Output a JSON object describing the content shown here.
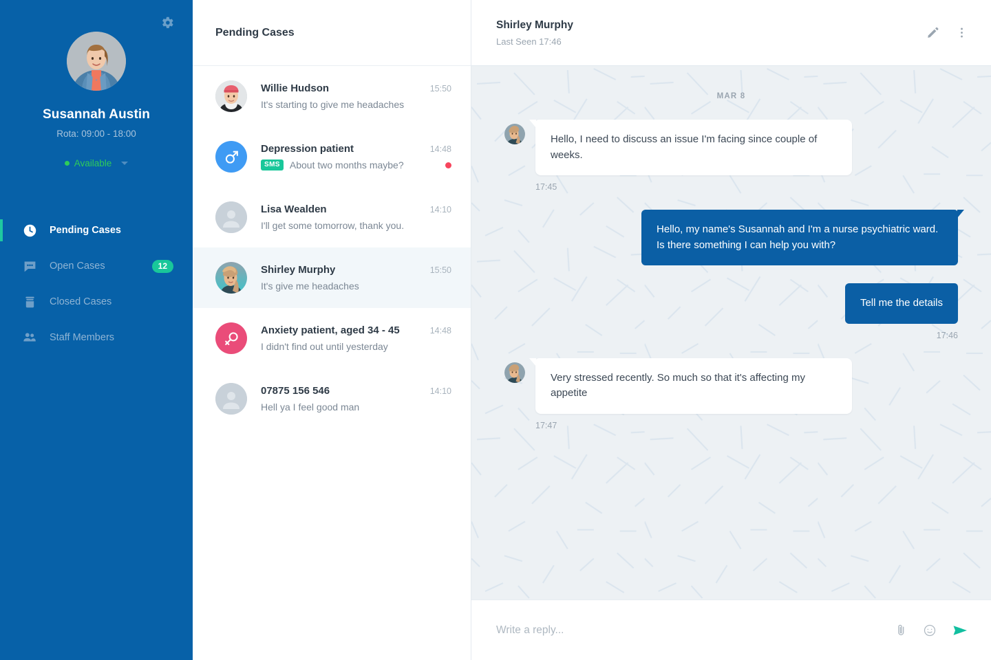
{
  "sidebar": {
    "gear_icon": "gear-icon",
    "profile": {
      "name": "Susannah Austin",
      "rota": "Rota: 09:00 - 18:00",
      "status": "Available",
      "status_color": "#2ecc5a",
      "avatar": "user-photo"
    },
    "nav": [
      {
        "label": "Pending Cases",
        "icon": "clock-icon",
        "active": true,
        "badge": ""
      },
      {
        "label": "Open Cases",
        "icon": "chat-icon",
        "active": false,
        "badge": "12"
      },
      {
        "label": "Closed Cases",
        "icon": "archive-icon",
        "active": false,
        "badge": ""
      },
      {
        "label": "Staff Members",
        "icon": "people-icon",
        "active": false,
        "badge": ""
      }
    ],
    "background_color": "#0761a8",
    "accent_color": "#1fc8a0"
  },
  "list": {
    "title": "Pending Cases",
    "cases": [
      {
        "name": "Willie Hudson",
        "preview": "It's starting to give me headaches",
        "time": "15:50",
        "avatar": "photo-man-beanie",
        "avatar_kind": "photo",
        "tag": "",
        "unread": false,
        "selected": false
      },
      {
        "name": "Depression patient",
        "preview": "About two months maybe?",
        "time": "14:48",
        "avatar": "male-symbol-icon",
        "avatar_kind": "male",
        "tag": "SMS",
        "unread": true,
        "selected": false
      },
      {
        "name": "Lisa Wealden",
        "preview": "I'll get some tomorrow, thank you.",
        "time": "14:10",
        "avatar": "placeholder-person-icon",
        "avatar_kind": "placeholder",
        "tag": "",
        "unread": false,
        "selected": false
      },
      {
        "name": "Shirley Murphy",
        "preview": "It's give me headaches",
        "time": "15:50",
        "avatar": "photo-woman",
        "avatar_kind": "photo2",
        "tag": "",
        "unread": false,
        "selected": true
      },
      {
        "name": "Anxiety patient, aged 34 - 45",
        "preview": "I didn't find out until yesterday",
        "time": "14:48",
        "avatar": "female-symbol-icon",
        "avatar_kind": "female",
        "tag": "",
        "unread": false,
        "selected": false
      },
      {
        "name": "07875 156 546",
        "preview": "Hell ya I feel good man",
        "time": "14:10",
        "avatar": "placeholder-person-icon",
        "avatar_kind": "placeholder",
        "tag": "",
        "unread": false,
        "selected": false
      }
    ]
  },
  "chat": {
    "title": "Shirley Murphy",
    "subtitle": "Last Seen 17:46",
    "edit_icon": "pencil-icon",
    "more_icon": "more-vertical-icon",
    "day_separator": "MAR 8",
    "messages": [
      {
        "dir": "in",
        "text": "Hello, I need to discuss an issue I'm facing since couple of weeks.",
        "time": "17:45",
        "avatar": true,
        "tail": true
      },
      {
        "dir": "out",
        "text": "Hello, my name's Susannah and I'm a nurse psychiatric ward. Is there something I can help you with?",
        "time": "",
        "avatar": false,
        "tail": true
      },
      {
        "dir": "out",
        "text": "Tell me the details",
        "time": "17:46",
        "avatar": false,
        "tail": false
      },
      {
        "dir": "in",
        "text": "Very stressed recently. So much so that it's affecting my appetite",
        "time": "17:47",
        "avatar": true,
        "tail": true
      }
    ],
    "composer": {
      "placeholder": "Write a reply...",
      "value": "",
      "attach_icon": "paperclip-icon",
      "emoji_icon": "smiley-icon",
      "send_icon": "send-icon",
      "send_color": "#12bfa0"
    },
    "background_color": "#edf1f4",
    "bubble_out_color": "#0b5fa5"
  }
}
